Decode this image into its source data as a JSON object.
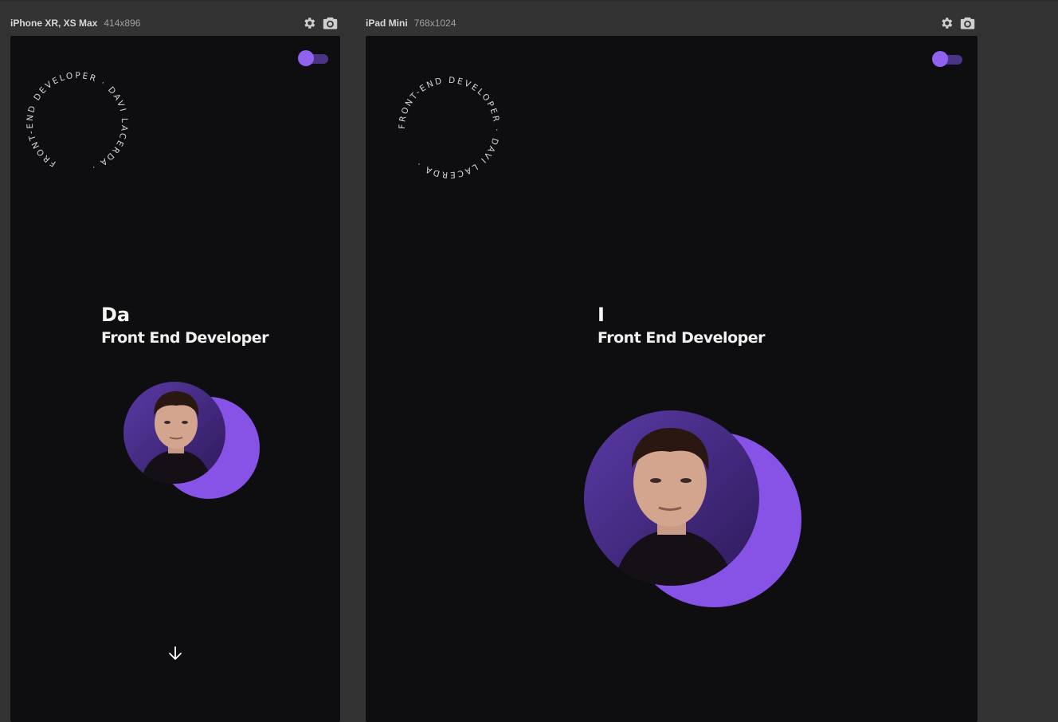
{
  "devices": [
    {
      "name": "iPhone XR, XS Max",
      "size": "414x896",
      "circle_text": "FRONT-END DEVELOPER · DAVI LACERDA · ",
      "typed_text": "Da",
      "role": "Front End Developer"
    },
    {
      "name": "iPad Mini",
      "size": "768x1024",
      "circle_text": "FRONT-END DEVELOPER · DAVI LACERDA · ",
      "typed_text": "I",
      "role": "Front End Developer"
    }
  ],
  "icons": {
    "settings": "gear-icon",
    "screenshot": "camera-icon",
    "scroll": "arrow-down-icon",
    "theme": "theme-toggle"
  },
  "colors": {
    "accent": "#8653e6",
    "toggle_knob": "#8f62f0",
    "toggle_track": "#4a3485",
    "page_bg": "#0e0e11",
    "chrome_bg": "#333333"
  }
}
